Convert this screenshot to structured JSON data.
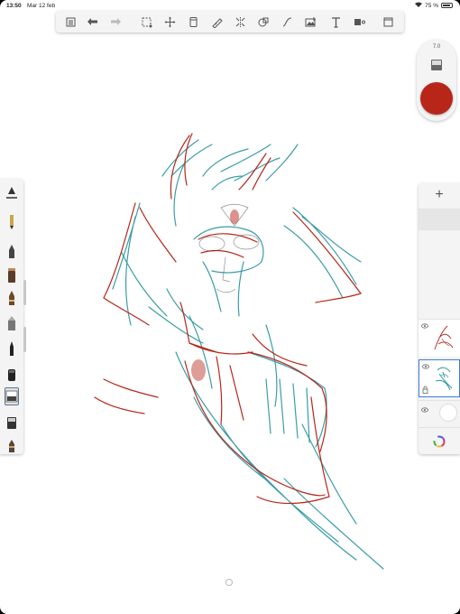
{
  "status_bar": {
    "time": "13:50",
    "date": "Mar 12 feb",
    "battery": "75 %"
  },
  "toolbar": {
    "tools": [
      "gallery-icon",
      "undo-icon",
      "redo-icon",
      "selection-icon",
      "transform-icon",
      "layer-stack-icon",
      "ruler-icon",
      "symmetry-icon",
      "shape-icon",
      "curve-icon",
      "image-icon",
      "text-icon",
      "perspective-icon",
      "fullscreen-icon"
    ]
  },
  "brush_size": {
    "value": "7.0"
  },
  "colors": {
    "current": "#b8261a",
    "accent": "#3d7ed6",
    "sketch_red": "#b8261a",
    "sketch_teal": "#3b9da6"
  },
  "brushes": [
    "ruler-brush",
    "pencil",
    "marker",
    "ink-pen",
    "paint-tube",
    "fountain-pen",
    "eraser-block",
    "nib-pen",
    "airbrush",
    "smudge-block",
    "felt-pen"
  ],
  "layers": {
    "add_label": "+",
    "items": [
      {
        "name": "red-sketch-layer",
        "visible": true,
        "selected": false
      },
      {
        "name": "teal-sketch-layer",
        "visible": true,
        "selected": true
      }
    ]
  }
}
